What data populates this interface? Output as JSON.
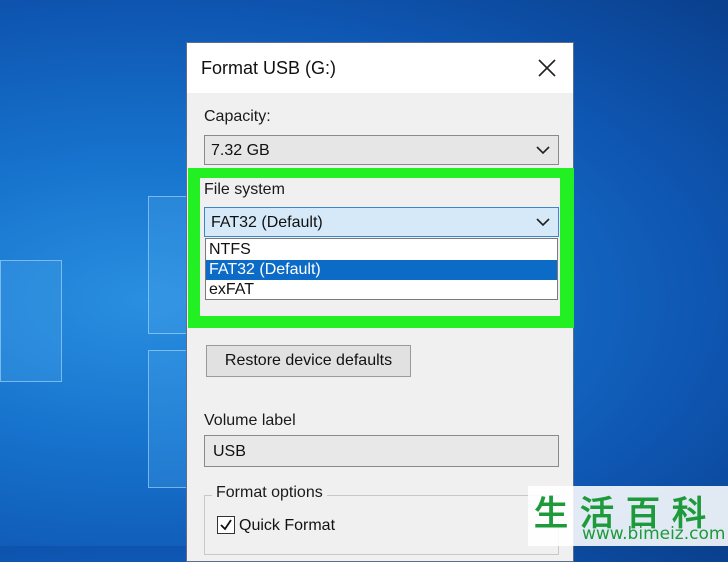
{
  "dialog": {
    "title": "Format USB (G:)",
    "capacity_label": "Capacity:",
    "capacity_value": "7.32 GB",
    "file_system_label": "File system",
    "file_system_value": "FAT32 (Default)",
    "file_system_options": [
      "NTFS",
      "FAT32 (Default)",
      "exFAT"
    ],
    "restore_button": "Restore device defaults",
    "volume_label_label": "Volume label",
    "volume_label_value": "USB",
    "format_options_label": "Format options",
    "quick_format_label": "Quick Format",
    "quick_format_checked": true
  },
  "watermark": {
    "chars": "生活百科",
    "url": "www.bimeiz.com"
  },
  "colors": {
    "highlight": "#22f022",
    "selected_item": "#0b6bc7",
    "watermark": "#1d9a3a"
  }
}
